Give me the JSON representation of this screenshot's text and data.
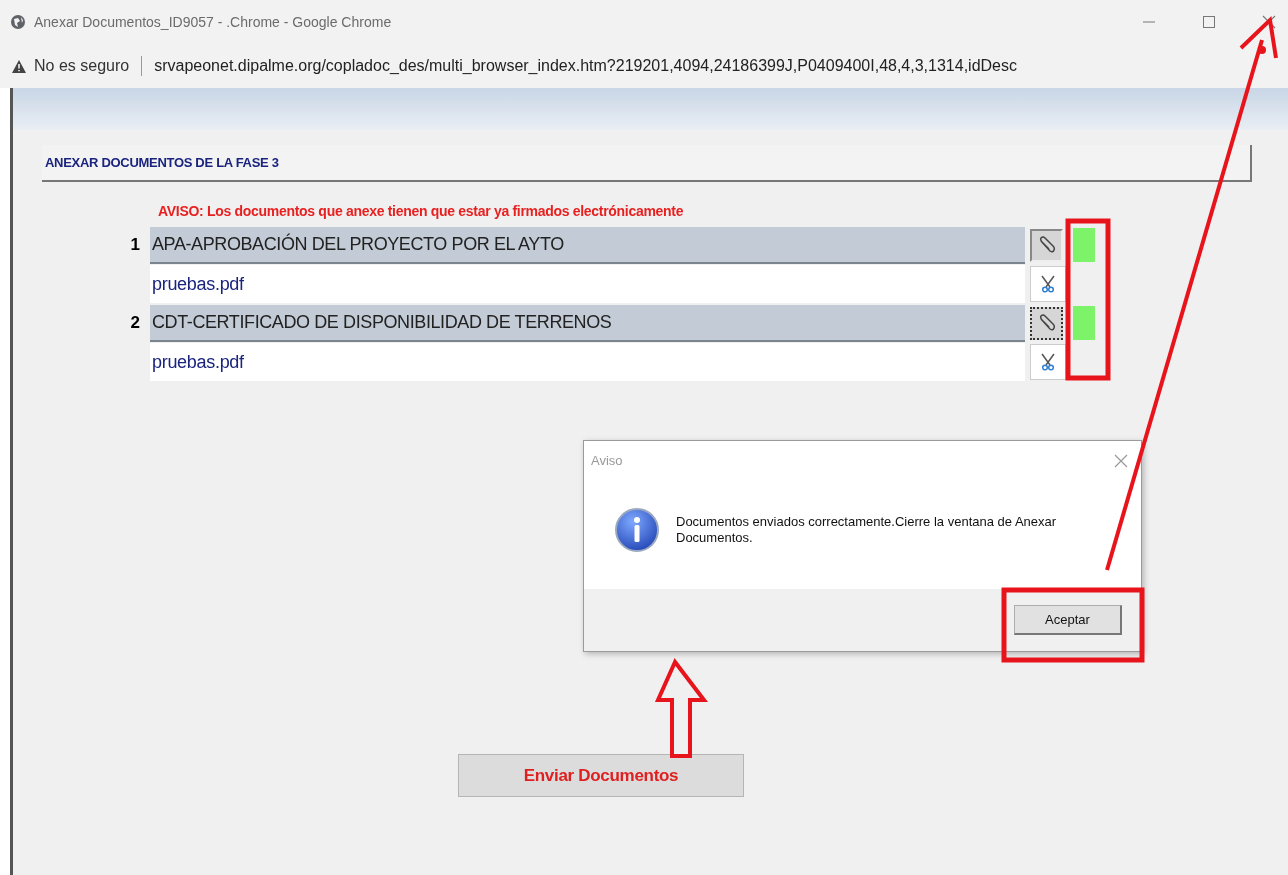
{
  "window": {
    "title": "Anexar Documentos_ID9057 - .Chrome - Google Chrome"
  },
  "address_bar": {
    "security": "No es seguro",
    "url": "srvapeonet.dipalme.org/copladoc_des/multi_browser_index.htm?219201,4094,24186399J,P0409400I,48,4,3,1314,idDesc"
  },
  "page": {
    "heading": "ANEXAR DOCUMENTOS DE LA FASE 3",
    "warning": "AVISO: Los documentos que anexe tienen que estar ya firmados electrónicamente",
    "documents": [
      {
        "number": "1",
        "name": "APA-APROBACIÓN DEL PROYECTO POR EL AYTO",
        "file": "pruebas.pdf",
        "attached": true,
        "focused": false
      },
      {
        "number": "2",
        "name": "CDT-CERTIFICADO DE DISPONIBILIDAD DE TERRENOS",
        "file": "pruebas.pdf",
        "attached": true,
        "focused": true
      }
    ],
    "send_button": "Enviar Documentos"
  },
  "dialog": {
    "title": "Aviso",
    "message": "Documentos enviados correctamente.Cierre la ventana de Anexar Documentos.",
    "button": "Aceptar"
  }
}
